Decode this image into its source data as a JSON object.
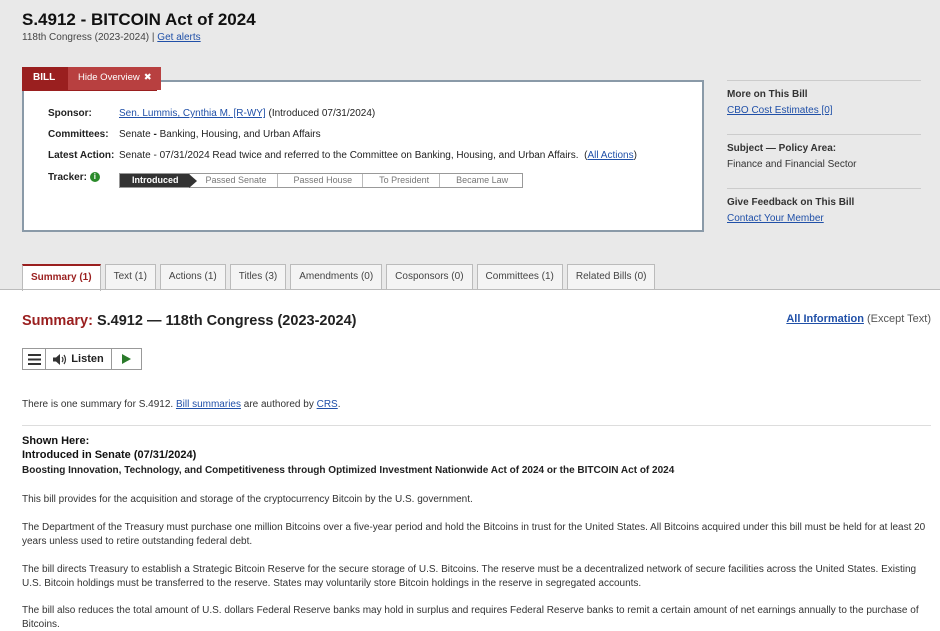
{
  "bill": {
    "title": "S.4912 - BITCOIN Act of 2024",
    "congress": "118th Congress (2023-2024)",
    "separator": "|",
    "alerts_link": "Get alerts"
  },
  "overview": {
    "bill_tab": "BILL",
    "hide_tab": "Hide Overview",
    "hide_icon": "✖",
    "sponsor_label": "Sponsor:",
    "sponsor_name": "Sen. Lummis, Cynthia M. [R-WY]",
    "sponsor_intro": "(Introduced 07/31/2024)",
    "committees_label": "Committees:",
    "committees_chamber": "Senate",
    "committees_dash": " - ",
    "committees_value": "Banking, Housing, and Urban Affairs",
    "latest_label": "Latest Action:",
    "latest_value": "Senate - 07/31/2024 Read twice and referred to the Committee on Banking, Housing, and Urban Affairs.",
    "all_actions_open": "(",
    "all_actions": "All Actions",
    "all_actions_close": ")",
    "tracker_label": "Tracker:",
    "tracker_info_icon": "i",
    "tracker_steps": [
      "Introduced",
      "Passed Senate",
      "Passed House",
      "To President",
      "Became Law"
    ]
  },
  "sidebar": {
    "more_title": "More on This Bill",
    "more_link": "CBO Cost Estimates [0]",
    "subject_title": "Subject — Policy Area:",
    "subject_value": "Finance and Financial Sector",
    "feedback_title": "Give Feedback on This Bill",
    "feedback_link": "Contact Your Member"
  },
  "tabs": [
    "Summary (1)",
    "Text (1)",
    "Actions (1)",
    "Titles (3)",
    "Amendments (0)",
    "Cosponsors (0)",
    "Committees (1)",
    "Related Bills (0)"
  ],
  "summary": {
    "heading_prefix": "Summary:",
    "heading": "S.4912 — 118th Congress (2023-2024)",
    "all_info": "All Information",
    "except_text": "(Except Text)",
    "listen": "Listen",
    "note_pre": "There is one summary for S.4912.",
    "note_link1": "Bill summaries",
    "note_mid": "are authored by",
    "note_link2": "CRS",
    "note_end": ".",
    "shown_here": "Shown Here:",
    "introduced": "Introduced in Senate (07/31/2024)",
    "long_title": "Boosting Innovation, Technology, and Competitiveness through Optimized Investment Nationwide Act of 2024 or the BITCOIN Act of 2024",
    "paragraphs": [
      "This bill provides for the acquisition and storage of the cryptocurrency Bitcoin by the U.S. government.",
      "The Department of the Treasury must purchase one million Bitcoins over a five-year period and hold the Bitcoins in trust for the United States. All Bitcoins acquired under this bill must be held for at least 20 years unless used to retire outstanding federal debt.",
      "The bill directs Treasury to establish a Strategic Bitcoin Reserve for the secure storage of U.S. Bitcoins. The reserve must be a decentralized network of secure facilities across the United States. Existing U.S. Bitcoin holdings must be transferred to the reserve. States may voluntarily store Bitcoin holdings in the reserve in segregated accounts.",
      "The bill also reduces the total amount of U.S. dollars Federal Reserve banks may hold in surplus and requires Federal Reserve banks to remit a certain amount of net earnings annually to the purchase of Bitcoins."
    ]
  }
}
